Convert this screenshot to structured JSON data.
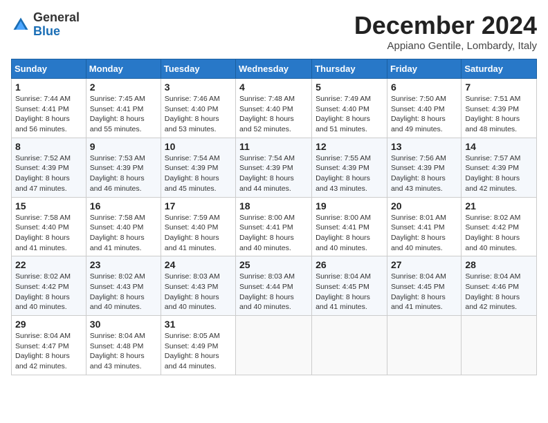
{
  "header": {
    "logo_general": "General",
    "logo_blue": "Blue",
    "month_title": "December 2024",
    "location": "Appiano Gentile, Lombardy, Italy"
  },
  "calendar": {
    "days_of_week": [
      "Sunday",
      "Monday",
      "Tuesday",
      "Wednesday",
      "Thursday",
      "Friday",
      "Saturday"
    ],
    "weeks": [
      [
        null,
        null,
        null,
        null,
        null,
        null,
        null
      ]
    ]
  },
  "cells": {
    "d1": {
      "num": "1",
      "info": "Sunrise: 7:44 AM\nSunset: 4:41 PM\nDaylight: 8 hours\nand 56 minutes."
    },
    "d2": {
      "num": "2",
      "info": "Sunrise: 7:45 AM\nSunset: 4:41 PM\nDaylight: 8 hours\nand 55 minutes."
    },
    "d3": {
      "num": "3",
      "info": "Sunrise: 7:46 AM\nSunset: 4:40 PM\nDaylight: 8 hours\nand 53 minutes."
    },
    "d4": {
      "num": "4",
      "info": "Sunrise: 7:48 AM\nSunset: 4:40 PM\nDaylight: 8 hours\nand 52 minutes."
    },
    "d5": {
      "num": "5",
      "info": "Sunrise: 7:49 AM\nSunset: 4:40 PM\nDaylight: 8 hours\nand 51 minutes."
    },
    "d6": {
      "num": "6",
      "info": "Sunrise: 7:50 AM\nSunset: 4:40 PM\nDaylight: 8 hours\nand 49 minutes."
    },
    "d7": {
      "num": "7",
      "info": "Sunrise: 7:51 AM\nSunset: 4:39 PM\nDaylight: 8 hours\nand 48 minutes."
    },
    "d8": {
      "num": "8",
      "info": "Sunrise: 7:52 AM\nSunset: 4:39 PM\nDaylight: 8 hours\nand 47 minutes."
    },
    "d9": {
      "num": "9",
      "info": "Sunrise: 7:53 AM\nSunset: 4:39 PM\nDaylight: 8 hours\nand 46 minutes."
    },
    "d10": {
      "num": "10",
      "info": "Sunrise: 7:54 AM\nSunset: 4:39 PM\nDaylight: 8 hours\nand 45 minutes."
    },
    "d11": {
      "num": "11",
      "info": "Sunrise: 7:54 AM\nSunset: 4:39 PM\nDaylight: 8 hours\nand 44 minutes."
    },
    "d12": {
      "num": "12",
      "info": "Sunrise: 7:55 AM\nSunset: 4:39 PM\nDaylight: 8 hours\nand 43 minutes."
    },
    "d13": {
      "num": "13",
      "info": "Sunrise: 7:56 AM\nSunset: 4:39 PM\nDaylight: 8 hours\nand 43 minutes."
    },
    "d14": {
      "num": "14",
      "info": "Sunrise: 7:57 AM\nSunset: 4:39 PM\nDaylight: 8 hours\nand 42 minutes."
    },
    "d15": {
      "num": "15",
      "info": "Sunrise: 7:58 AM\nSunset: 4:40 PM\nDaylight: 8 hours\nand 41 minutes."
    },
    "d16": {
      "num": "16",
      "info": "Sunrise: 7:58 AM\nSunset: 4:40 PM\nDaylight: 8 hours\nand 41 minutes."
    },
    "d17": {
      "num": "17",
      "info": "Sunrise: 7:59 AM\nSunset: 4:40 PM\nDaylight: 8 hours\nand 41 minutes."
    },
    "d18": {
      "num": "18",
      "info": "Sunrise: 8:00 AM\nSunset: 4:41 PM\nDaylight: 8 hours\nand 40 minutes."
    },
    "d19": {
      "num": "19",
      "info": "Sunrise: 8:00 AM\nSunset: 4:41 PM\nDaylight: 8 hours\nand 40 minutes."
    },
    "d20": {
      "num": "20",
      "info": "Sunrise: 8:01 AM\nSunset: 4:41 PM\nDaylight: 8 hours\nand 40 minutes."
    },
    "d21": {
      "num": "21",
      "info": "Sunrise: 8:02 AM\nSunset: 4:42 PM\nDaylight: 8 hours\nand 40 minutes."
    },
    "d22": {
      "num": "22",
      "info": "Sunrise: 8:02 AM\nSunset: 4:42 PM\nDaylight: 8 hours\nand 40 minutes."
    },
    "d23": {
      "num": "23",
      "info": "Sunrise: 8:02 AM\nSunset: 4:43 PM\nDaylight: 8 hours\nand 40 minutes."
    },
    "d24": {
      "num": "24",
      "info": "Sunrise: 8:03 AM\nSunset: 4:43 PM\nDaylight: 8 hours\nand 40 minutes."
    },
    "d25": {
      "num": "25",
      "info": "Sunrise: 8:03 AM\nSunset: 4:44 PM\nDaylight: 8 hours\nand 40 minutes."
    },
    "d26": {
      "num": "26",
      "info": "Sunrise: 8:04 AM\nSunset: 4:45 PM\nDaylight: 8 hours\nand 41 minutes."
    },
    "d27": {
      "num": "27",
      "info": "Sunrise: 8:04 AM\nSunset: 4:45 PM\nDaylight: 8 hours\nand 41 minutes."
    },
    "d28": {
      "num": "28",
      "info": "Sunrise: 8:04 AM\nSunset: 4:46 PM\nDaylight: 8 hours\nand 42 minutes."
    },
    "d29": {
      "num": "29",
      "info": "Sunrise: 8:04 AM\nSunset: 4:47 PM\nDaylight: 8 hours\nand 42 minutes."
    },
    "d30": {
      "num": "30",
      "info": "Sunrise: 8:04 AM\nSunset: 4:48 PM\nDaylight: 8 hours\nand 43 minutes."
    },
    "d31": {
      "num": "31",
      "info": "Sunrise: 8:05 AM\nSunset: 4:49 PM\nDaylight: 8 hours\nand 44 minutes."
    }
  },
  "days_header": [
    "Sunday",
    "Monday",
    "Tuesday",
    "Wednesday",
    "Thursday",
    "Friday",
    "Saturday"
  ]
}
